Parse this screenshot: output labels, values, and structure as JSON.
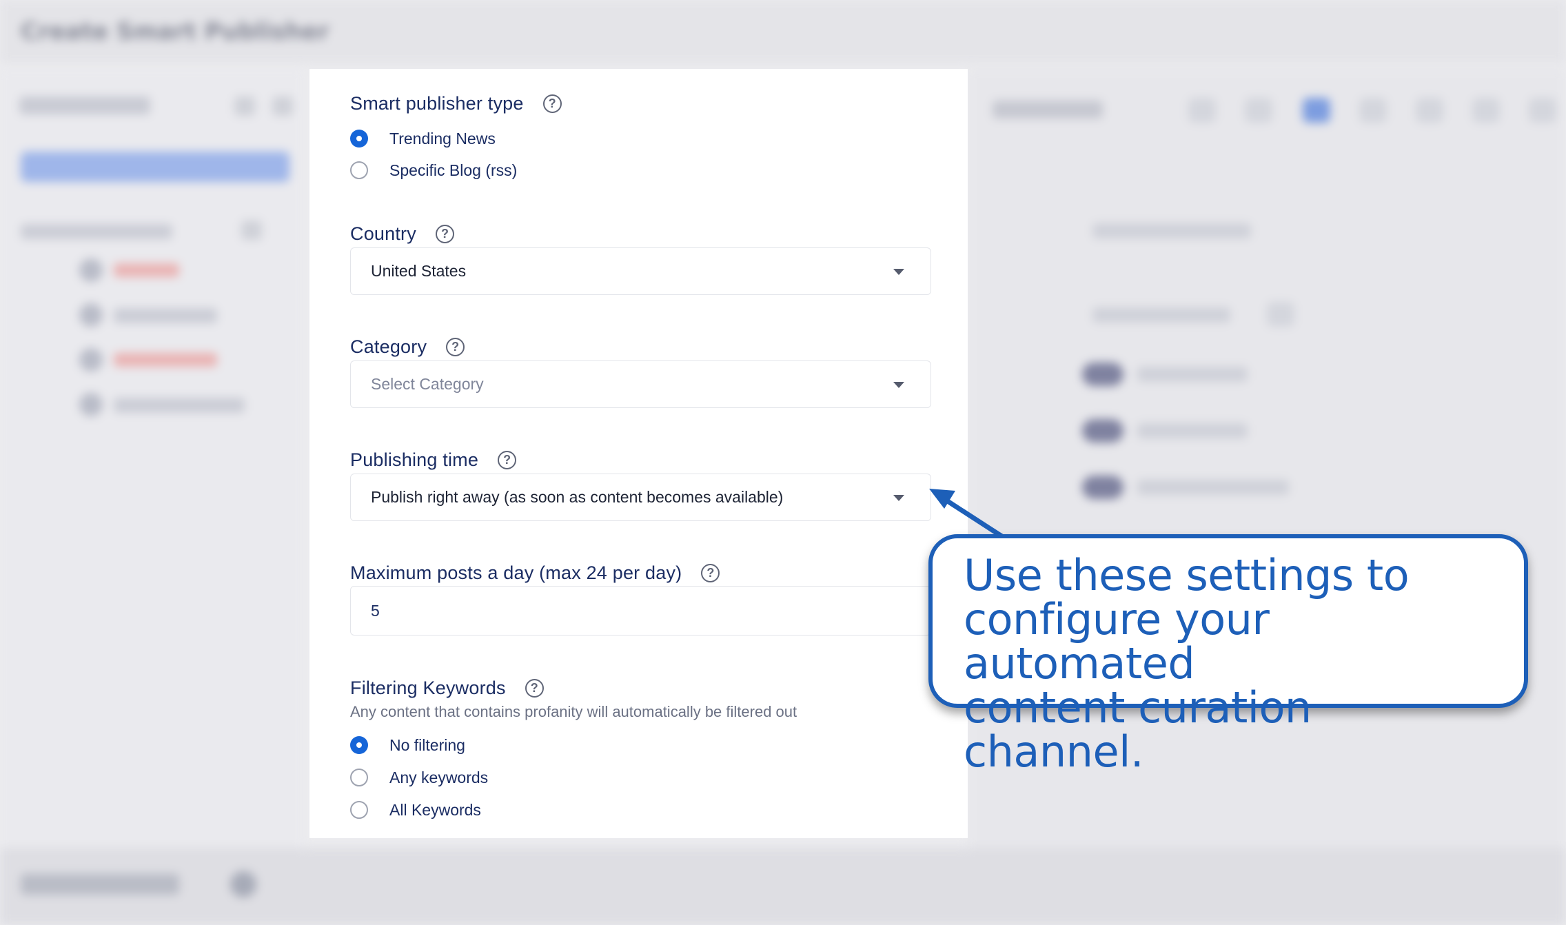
{
  "background": {
    "window_title": "Create Smart Publisher"
  },
  "form": {
    "publisher_type": {
      "label": "Smart publisher type",
      "help_glyph": "?",
      "options": [
        {
          "label": "Trending News",
          "selected": true
        },
        {
          "label": "Specific Blog (rss)",
          "selected": false
        }
      ]
    },
    "country": {
      "label": "Country",
      "help_glyph": "?",
      "value": "United States"
    },
    "category": {
      "label": "Category",
      "help_glyph": "?",
      "placeholder": "Select Category"
    },
    "publishing_time": {
      "label": "Publishing time",
      "help_glyph": "?",
      "value": "Publish right away (as soon as content becomes available)"
    },
    "max_posts": {
      "label": "Maximum posts a day (max 24 per day)",
      "help_glyph": "?",
      "value": "5"
    },
    "filtering": {
      "label": "Filtering Keywords",
      "help_glyph": "?",
      "description": "Any content that contains profanity will automatically be filtered out",
      "options": [
        {
          "label": "No filtering",
          "selected": true
        },
        {
          "label": "Any keywords",
          "selected": false
        },
        {
          "label": "All Keywords",
          "selected": false
        }
      ]
    }
  },
  "callout": {
    "line1": "Use these settings to",
    "line2": "configure your automated",
    "line3": "content curation channel."
  },
  "colors": {
    "accent": "#1565d8",
    "callout_blue": "#1d5fb8",
    "label_navy": "#1b2d63"
  },
  "icons": [
    "help-circle-icon",
    "chevron-down-icon",
    "radio-selected-icon",
    "radio-unselected-icon",
    "callout-arrow-icon"
  ]
}
